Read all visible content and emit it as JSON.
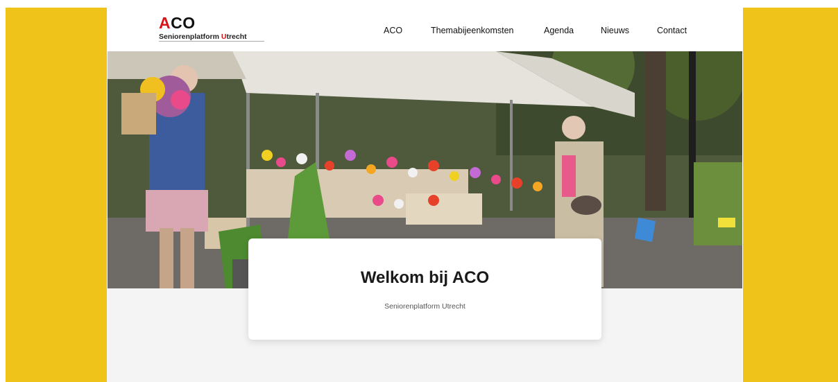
{
  "logo": {
    "title_prefix": "A",
    "title_rest": "CO",
    "subtitle_prefix": "Seniorenplatform ",
    "subtitle_u": "U",
    "subtitle_rest": "trecht"
  },
  "nav": {
    "items": [
      {
        "label": "ACO"
      },
      {
        "label": "Themabijeenkomsten"
      },
      {
        "label": "Agenda"
      },
      {
        "label": "Nieuws"
      },
      {
        "label": "Contact"
      }
    ]
  },
  "hero": {
    "image": "flower-market-photo"
  },
  "welcome": {
    "title": "Welkom bij ACO",
    "subtitle": "Seniorenplatform Utrecht"
  },
  "colors": {
    "side_bars": "#efc31a",
    "brand_red": "#d8141b",
    "page_bg": "#f4f4f4"
  }
}
